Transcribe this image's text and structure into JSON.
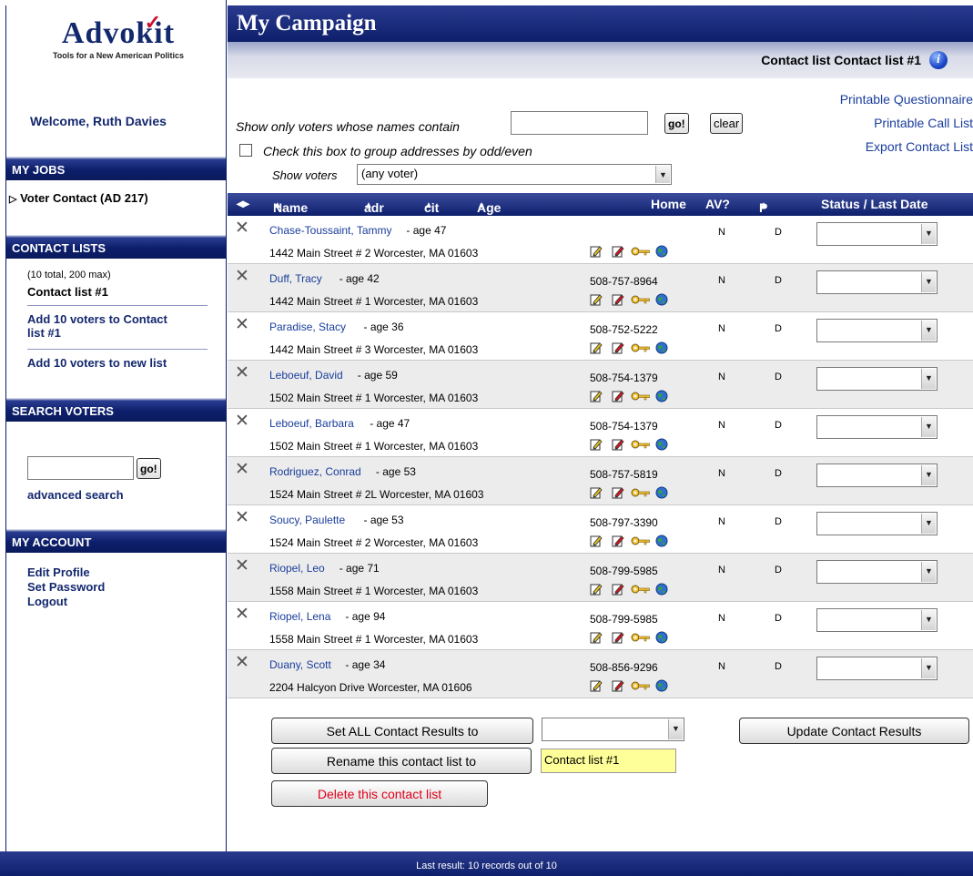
{
  "logo": {
    "name": "Advokit",
    "tagline": "Tools for a New American Politics"
  },
  "welcome": "Welcome, Ruth Davies",
  "sidebar": {
    "jobs_header": "MY JOBS",
    "jobs": [
      "Voter Contact (AD 217)"
    ],
    "lists_header": "CONTACT LISTS",
    "lists_count": "(10 total, 200 max)",
    "current_list": "Contact list #1",
    "add_to_current": "Add 10 voters to Contact list #1",
    "add_to_new": "Add 10 voters to new list",
    "search_header": "SEARCH VOTERS",
    "search_go": "go!",
    "advanced_search": "advanced search",
    "account_header": "MY ACCOUNT",
    "account_links": [
      "Edit Profile",
      "Set Password",
      "Logout"
    ]
  },
  "main": {
    "title": "My Campaign",
    "list_heading": "Contact list Contact list #1",
    "info_glyph": "i",
    "filter_label": "Show only voters whose names contain",
    "filter_value": "",
    "go_label": "go!",
    "clear_label": "clear",
    "group_label": "Check this box to group addresses by odd/even",
    "show_voters_label": "Show voters",
    "show_voters_value": "(any voter)",
    "links": [
      "Printable Questionnaire",
      "Printable Call List",
      "Export Contact List"
    ]
  },
  "table": {
    "columns": {
      "name": "Name",
      "adr": "adr",
      "cit": "cit",
      "age": "Age",
      "home": "Home",
      "av": "AV?",
      "p": "P",
      "status": "Status / Last Date"
    },
    "rows": [
      {
        "name": "Chase-Toussaint, Tammy",
        "age": "- age 47",
        "address": "1442 Main Street # 2   Worcester, MA  01603",
        "phone": "",
        "av": "N",
        "p": "D"
      },
      {
        "name": "Duff, Tracy",
        "age": "- age 42",
        "address": "1442 Main Street # 1   Worcester, MA  01603",
        "phone": "508-757-8964",
        "av": "N",
        "p": "D"
      },
      {
        "name": "Paradise, Stacy",
        "age": "- age 36",
        "address": "1442 Main Street # 3   Worcester, MA  01603",
        "phone": "508-752-5222",
        "av": "N",
        "p": "D"
      },
      {
        "name": "Leboeuf, David",
        "age": "- age 59",
        "address": "1502 Main Street # 1   Worcester, MA  01603",
        "phone": "508-754-1379",
        "av": "N",
        "p": "D"
      },
      {
        "name": "Leboeuf, Barbara",
        "age": "- age 47",
        "address": "1502 Main Street # 1   Worcester, MA  01603",
        "phone": "508-754-1379",
        "av": "N",
        "p": "D"
      },
      {
        "name": "Rodriguez, Conrad",
        "age": "- age 53",
        "address": "1524 Main Street # 2L   Worcester, MA  01603",
        "phone": "508-757-5819",
        "av": "N",
        "p": "D"
      },
      {
        "name": "Soucy, Paulette",
        "age": "- age 53",
        "address": "1524 Main Street # 2   Worcester, MA  01603",
        "phone": "508-797-3390",
        "av": "N",
        "p": "D"
      },
      {
        "name": "Riopel, Leo",
        "age": "- age 71",
        "address": "1558 Main Street # 1   Worcester, MA  01603",
        "phone": "508-799-5985",
        "av": "N",
        "p": "D"
      },
      {
        "name": "Riopel, Lena",
        "age": "- age 94",
        "address": "1558 Main Street # 1   Worcester, MA  01603",
        "phone": "508-799-5985",
        "av": "N",
        "p": "D"
      },
      {
        "name": "Duany, Scott",
        "age": "- age 34",
        "address": "2204 Halcyon Drive   Worcester, MA  01606",
        "phone": "508-856-9296",
        "av": "N",
        "p": "D"
      }
    ]
  },
  "actions": {
    "set_all": "Set ALL Contact Results to",
    "update": "Update Contact Results",
    "rename": "Rename this contact list to",
    "rename_value": "Contact list #1",
    "delete": "Delete this contact list"
  },
  "footer": "Last result:  10 records out of 10",
  "colors": {
    "navy": "#0d1f6b",
    "link": "#1a3d9c",
    "delete": "#e0001a",
    "rename_bg": "#ffff99"
  }
}
